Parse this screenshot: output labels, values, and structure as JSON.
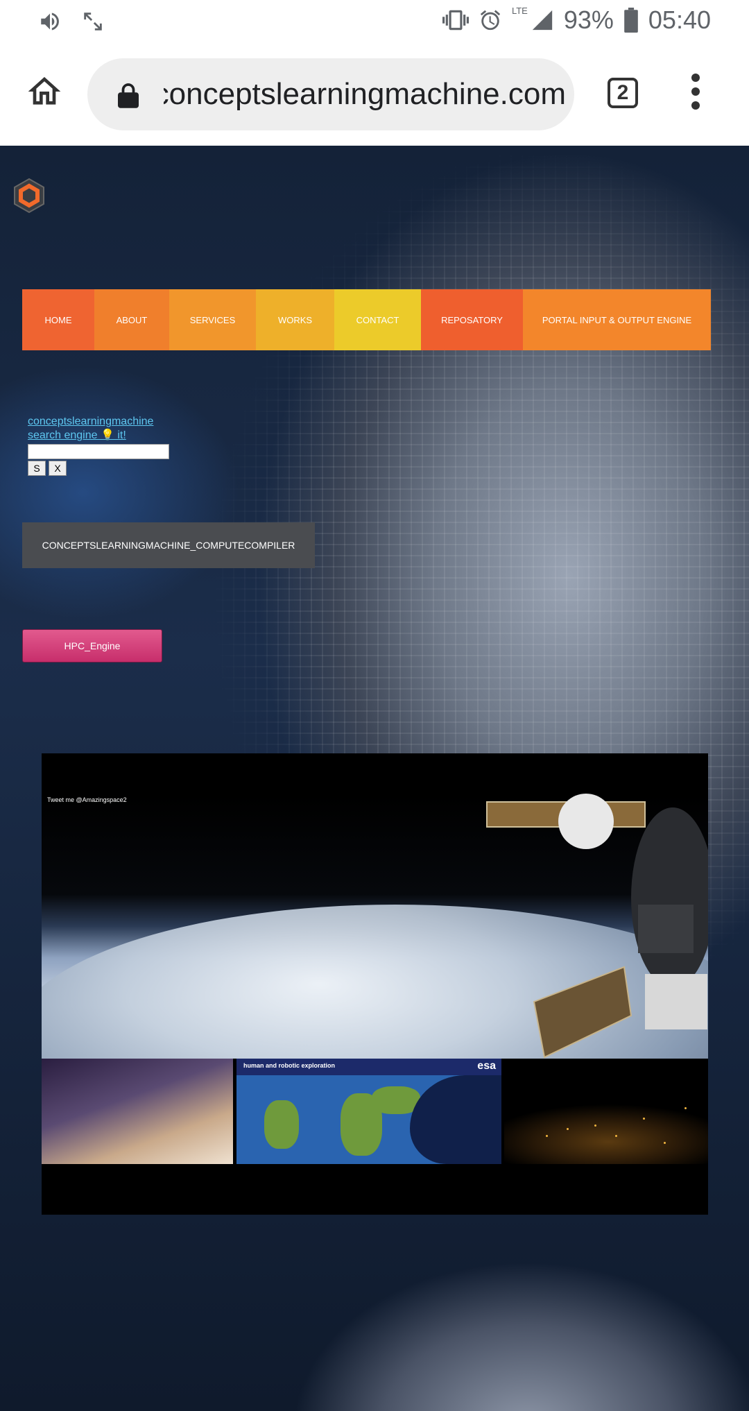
{
  "status_bar": {
    "battery_percent": "93%",
    "time": "05:40",
    "network": "LTE",
    "icons": [
      "volume-icon",
      "screen-rotate-icon",
      "vibrate-icon",
      "alarm-icon",
      "signal-icon",
      "battery-icon"
    ]
  },
  "browser": {
    "url": "conceptslearningmachine.com",
    "tab_count": "2",
    "icons": [
      "home-icon",
      "lock-icon",
      "tabs-icon",
      "more-vert-icon"
    ]
  },
  "nav": {
    "items": [
      {
        "label": "HOME",
        "color": "#ef6431"
      },
      {
        "label": "ABOUT",
        "color": "#f07f2c"
      },
      {
        "label": "SERVICES",
        "color": "#f1962c"
      },
      {
        "label": "WORKS",
        "color": "#eeb02a"
      },
      {
        "label": "CONTACT",
        "color": "#eccb2a"
      },
      {
        "label": "REPOSATORY",
        "color": "#ef5f2e"
      },
      {
        "label": "PORTAL INPUT & OUTPUT ENGINE",
        "color": "#f3862b"
      }
    ]
  },
  "search": {
    "label_line1": "conceptslearningmachine",
    "label_line2": "search engine 💡 it!",
    "input_value": "",
    "submit_label": "S",
    "clear_label": "X"
  },
  "compiler_button": {
    "label": "CONCEPTSLEARNINGMACHINE_COMPUTECOMPILER"
  },
  "hpc_button": {
    "label": "HPC_Engine"
  },
  "video": {
    "tweet_text": "Tweet me @Amazingspace2",
    "thumb2_title": "human and robotic exploration",
    "thumb2_logo": "esa"
  }
}
